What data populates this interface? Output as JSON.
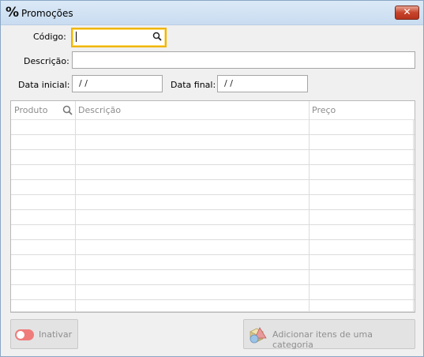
{
  "window": {
    "title": "Promoções",
    "title_icon": "percent-icon",
    "close_icon": "close-icon"
  },
  "form": {
    "codigo_label": "Código:",
    "codigo_value": "",
    "descricao_label": "Descrição:",
    "descricao_value": "",
    "data_inicial_label": "Data inicial:",
    "data_inicial_value": " /  /",
    "data_final_label": "Data final:",
    "data_final_value": " /  /"
  },
  "grid": {
    "columns": [
      "Produto",
      "Descrição",
      "Preço"
    ],
    "rows": []
  },
  "buttons": {
    "inativar": "Inativar",
    "adicionar_categoria": "Adicionar itens de uma categoria"
  },
  "colors": {
    "focus_border": "#f0b400",
    "toggle_off": "#f07b7b",
    "close_button": "#c7432a"
  }
}
